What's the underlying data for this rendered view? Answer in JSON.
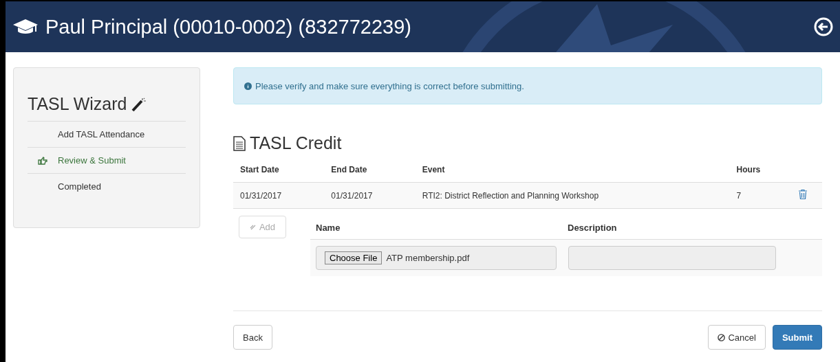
{
  "header": {
    "title": "Paul Principal (00010-0002) (832772239)"
  },
  "wizard": {
    "title": "TASL Wizard",
    "steps": [
      {
        "label": "Add TASL Attendance",
        "selected": false
      },
      {
        "label": "Review & Submit",
        "selected": true
      },
      {
        "label": "Completed",
        "selected": false
      }
    ]
  },
  "alert": {
    "text": "Please verify and make sure everything is correct before submitting."
  },
  "section": {
    "title": "TASL Credit"
  },
  "table": {
    "columns": [
      "Start Date",
      "End Date",
      "Event",
      "Hours"
    ],
    "rows": [
      {
        "cells": [
          "01/31/2017",
          "01/31/2017",
          "RTI2: District Reflection and Planning Workshop",
          "7"
        ]
      }
    ]
  },
  "attachments": {
    "add_button": {
      "label": "Add",
      "disabled": true
    },
    "columns": [
      "Name",
      "Description"
    ],
    "rows": [
      {
        "file_button": "Choose File",
        "file_name": "ATP membership.pdf"
      }
    ]
  },
  "buttons": {
    "back": "Back",
    "cancel": "Cancel",
    "submit": "Submit"
  }
}
